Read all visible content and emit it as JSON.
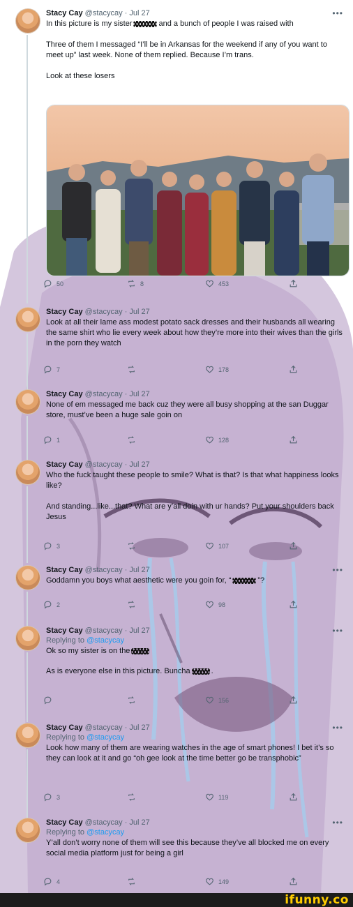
{
  "tweets": [
    {
      "name": "Stacy Cay",
      "handle": "@stacycay",
      "date": "Jul 27",
      "replying_label": "",
      "replying_handle": "",
      "text_a": "In this picture is my sister",
      "text_b": "and a bunch of people I was raised with\n\nThree of them I messaged “I’ll be in Arkansas for the weekend if any of you want to meet up” last week. None of them replied. Because I’m trans.\n\nLook at these losers",
      "replies": "50",
      "retweets": "8",
      "likes": "453"
    },
    {
      "name": "Stacy Cay",
      "handle": "@stacycay",
      "date": "Jul 27",
      "text_a": "Look at all their lame ass modest potato sack dresses and their husbands all wearing the same shirt who lie every week about how they’re more into their wives than the girls in the porn they watch",
      "text_b": "",
      "replies": "7",
      "retweets": "",
      "likes": "178"
    },
    {
      "name": "Stacy Cay",
      "handle": "@stacycay",
      "date": "Jul 27",
      "text_a": "None of em messaged me back cuz they were all busy shopping at the san Duggar store, must’ve been a huge sale goin on",
      "text_b": "",
      "replies": "1",
      "retweets": "",
      "likes": "128"
    },
    {
      "name": "Stacy Cay",
      "handle": "@stacycay",
      "date": "Jul 27",
      "text_a": "Who the fuck taught these people to smile? What is that? Is that what happiness looks like?\n\nAnd standing...like...that? What are y’all doin with ur hands? Put your shoulders back Jesus",
      "text_b": "",
      "replies": "3",
      "retweets": "",
      "likes": "107"
    },
    {
      "name": "Stacy Cay",
      "handle": "@stacycay",
      "date": "Jul 27",
      "text_a": "Goddamn you boys what aesthetic were you goin for, “",
      "text_b": "”?",
      "replies": "2",
      "retweets": "",
      "likes": "98"
    },
    {
      "name": "Stacy Cay",
      "handle": "@stacycay",
      "date": "Jul 27",
      "replying_label": "Replying to",
      "replying_handle": "@stacycay",
      "text_a": "Ok so my sister is on the",
      "text_b": "",
      "text_c": "As is everyone else in this picture. Buncha",
      "text_d": ".",
      "replies": "",
      "retweets": "",
      "likes": "156"
    },
    {
      "name": "Stacy Cay",
      "handle": "@stacycay",
      "date": "Jul 27",
      "replying_label": "Replying to",
      "replying_handle": "@stacycay",
      "text_a": "Look how many of them are wearing watches in the age of smart phones! I bet it’s so they can look at it and go “oh gee look at the time better go be transphobic”",
      "text_b": "",
      "replies": "3",
      "retweets": "",
      "likes": "119"
    },
    {
      "name": "Stacy Cay",
      "handle": "@stacycay",
      "date": "Jul 27",
      "replying_label": "Replying to",
      "replying_handle": "@stacycay",
      "text_a": "Y’all don’t worry none of them will see this because they’ve all blocked me on every social media platform just for being a girl",
      "text_b": "",
      "replies": "4",
      "retweets": "",
      "likes": "149"
    }
  ],
  "ui": {
    "more": "•••",
    "separator": "·",
    "brand": "ifunny.co"
  },
  "icons": {
    "reply": "reply-icon",
    "retweet": "retweet-icon",
    "like": "like-icon",
    "share": "share-icon"
  },
  "colors": {
    "overlay_purple": "#a58bb8",
    "brand_yellow": "#ffcc00",
    "muted": "#536471",
    "link": "#1d9bf0"
  }
}
